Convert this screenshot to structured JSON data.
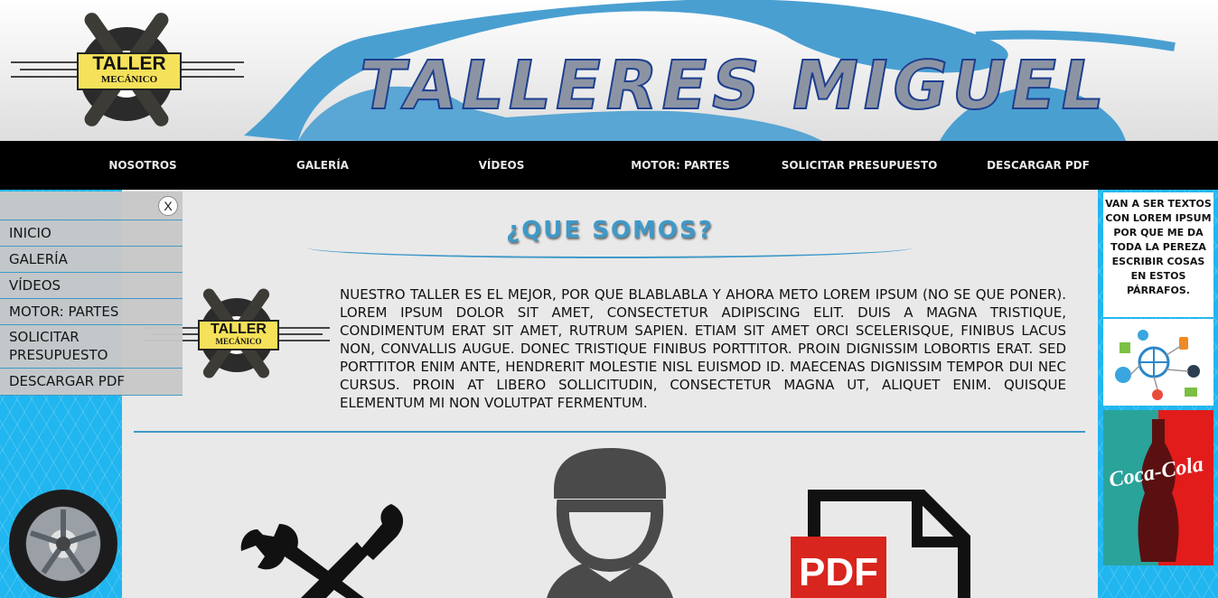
{
  "header": {
    "logo": {
      "line1": "TALLER",
      "line2": "MECÁNICO"
    },
    "site_title": "TALLERES MIGUEL",
    "car_silhouette_color": "#4a9fd1"
  },
  "nav": {
    "items": [
      "NOSOTROS",
      "GALERÍA",
      "VÍDEOS",
      "MOTOR: PARTES",
      "SOLICITAR PRESUPUESTO",
      "DESCARGAR PDF"
    ]
  },
  "side_menu": {
    "close_label": "X",
    "items": [
      "INICIO",
      "GALERÍA",
      "VÍDEOS",
      "MOTOR: PARTES",
      "SOLICITAR PRESUPUESTO",
      "DESCARGAR PDF"
    ]
  },
  "main": {
    "section_title": "¿QUE SOMOS?",
    "about_text": "NUESTRO TALLER ES EL MEJOR, POR QUE BLABLABLA Y AHORA METO LOREM IPSUM (NO SE QUE PONER). LOREM IPSUM DOLOR SIT AMET, CONSECTETUR ADIPISCING ELIT. DUIS A MAGNA TRISTIQUE, CONDIMENTUM ERAT SIT AMET, RUTRUM SAPIEN. ETIAM SIT AMET ORCI SCELERISQUE, FINIBUS LACUS NON, CONVALLIS AUGUE. DONEC TRISTIQUE FINIBUS PORTTITOR. PROIN DIGNISSIM LOBORTIS ERAT. SED PORTTITOR ENIM ANTE, HENDRERIT MOLESTIE NISL EUISMOD ID. MAECENAS DIGNISSIM TEMPOR DUI NEC CURSUS. PROIN AT LIBERO SOLLICITUDIN, CONSECTETUR MAGNA UT, ALIQUET ENIM. QUISQUE ELEMENTUM MI NON VOLUTPAT FERMENTUM.",
    "logo": {
      "line1": "TALLER",
      "line2": "MECÁNICO"
    },
    "icons": [
      "tools-icon",
      "mechanic-icon",
      "pdf-icon"
    ],
    "pdf_icon_label": "PDF"
  },
  "sidebar_right": {
    "ad_text": "VAN A SER TEXTOS CON LOREM IPSUM POR QUE ME DA TODA LA PEREZA ESCRIBIR COSAS EN ESTOS PÁRRAFOS.",
    "coke_label": "Coca-Cola"
  },
  "colors": {
    "nav_bg": "#000000",
    "accent_blue": "#3f99c8",
    "pattern_blue": "#20b6ef",
    "main_bg": "#e9e9e9",
    "pdf_red": "#d8251d",
    "icon_dark": "#4a4a4a"
  }
}
